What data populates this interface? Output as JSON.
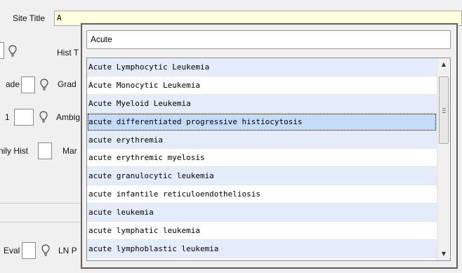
{
  "form": {
    "site_title_label": "Site Title",
    "site_title_value": "A",
    "hist_label": "Hist T",
    "grade_left_label": "ade",
    "grade_label": "Grad",
    "one_label": "1",
    "ambig_label": "Ambig",
    "family_hist_label": "nily Hist",
    "mar_label": "Mar",
    "eval_label": "Eval",
    "ln_label": "LN P"
  },
  "popup": {
    "search_value": "Acute",
    "items": [
      "Acute Lymphocytic Leukemia",
      "Acute Monocytic Leukemia",
      "Acute Myeloid Leukemia",
      "acute differentiated progressive histiocytosis",
      "acute erythremia",
      "acute erythremic myelosis",
      "acute granulocytic leukemia",
      "acute infantile reticuloendotheliosis",
      "acute leukemia",
      "acute lymphatic leukemia",
      "acute lymphoblastic leukemia"
    ],
    "selected_index": 3
  },
  "colors": {
    "site_title_bg": "#ffffe0",
    "row_alt": "#e3ecf8",
    "row_selected": "#c5dcf7"
  },
  "icons": {
    "hint": "lightbulb-icon",
    "scroll_up": "chevron-up-icon",
    "scroll_down": "chevron-down-icon"
  }
}
